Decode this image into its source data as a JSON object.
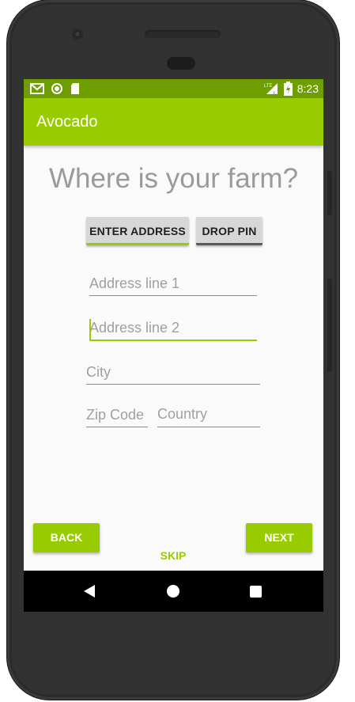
{
  "status_bar": {
    "time": "8:23",
    "network_label": "LTE",
    "left_icons": [
      "gmail-icon",
      "record-icon",
      "sd-card-icon"
    ],
    "right_icons": [
      "signal-icon",
      "battery-charging-icon"
    ]
  },
  "app_bar": {
    "title": "Avocado"
  },
  "main": {
    "heading": "Where is your farm?",
    "mode_buttons": {
      "enter_address": "ENTER ADDRESS",
      "drop_pin": "DROP PIN"
    },
    "fields": {
      "address_line_1": {
        "placeholder": "Address line 1",
        "value": ""
      },
      "address_line_2": {
        "placeholder": "Address line 2",
        "value": ""
      },
      "city": {
        "placeholder": "City",
        "value": ""
      },
      "zip_code": {
        "placeholder": "Zip Code",
        "value": ""
      },
      "country": {
        "placeholder": "Country",
        "value": ""
      }
    },
    "actions": {
      "back": "BACK",
      "skip": "SKIP",
      "next": "NEXT"
    }
  },
  "nav_bar": {
    "icons": [
      "back-icon",
      "home-icon",
      "recents-icon"
    ]
  },
  "colors": {
    "accent": "#99cc00",
    "status_bar": "#6f9e00",
    "heading_text": "#9a9a9a",
    "toggle_button_bg": "#d6d7d7",
    "nav_bar": "#000000"
  }
}
